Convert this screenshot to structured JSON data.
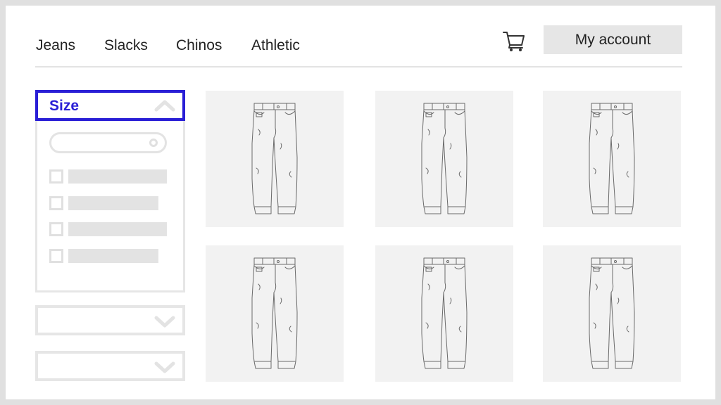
{
  "nav": {
    "categories": [
      "Jeans",
      "Slacks",
      "Chinos",
      "Athletic"
    ],
    "cart_icon": "shopping-cart-icon",
    "account_label": "My account"
  },
  "filters": {
    "size": {
      "title": "Size",
      "expanded": true,
      "toggle_icon": "chevron-up-icon",
      "search_icon": "circle-icon",
      "options_count": 4
    },
    "collapsed_sections": [
      {
        "title": "",
        "toggle_icon": "chevron-down-icon"
      },
      {
        "title": "",
        "toggle_icon": "chevron-down-icon"
      }
    ]
  },
  "products": [
    {
      "image": "jeans-image"
    },
    {
      "image": "jeans-image"
    },
    {
      "image": "jeans-image"
    },
    {
      "image": "jeans-image"
    },
    {
      "image": "jeans-image"
    },
    {
      "image": "jeans-image"
    }
  ],
  "colors": {
    "accent": "#2a1fd6",
    "placeholder": "#e3e3e3",
    "card_bg": "#f2f2f2",
    "frame": "#e0e0e0"
  }
}
